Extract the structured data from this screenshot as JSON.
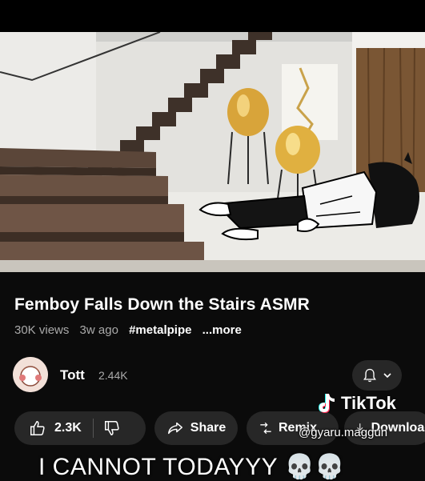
{
  "video": {
    "title": "Femboy Falls Down the Stairs ASMR",
    "views": "30K views",
    "age": "3w ago",
    "hashtag": "#metalpipe",
    "more": "...more"
  },
  "channel": {
    "name": "Tott",
    "subscribers": "2.44K"
  },
  "actions": {
    "likes": "2.3K",
    "share": "Share",
    "remix": "Remix",
    "download": "Download"
  },
  "overlay": {
    "brand": "TikTok",
    "handle": "@gyaru.maggun",
    "caption": "I CANNOT TODAYYY",
    "caption_emoji": "💀💀"
  },
  "icons": [
    "like-icon",
    "dislike-icon",
    "share-icon",
    "remix-icon",
    "download-icon",
    "bell-icon",
    "chevron-down-icon",
    "tiktok-logo-icon"
  ],
  "colors": {
    "background": "#0b0b0b",
    "pill": "#272727",
    "secondary_text": "#aaaaaa"
  }
}
